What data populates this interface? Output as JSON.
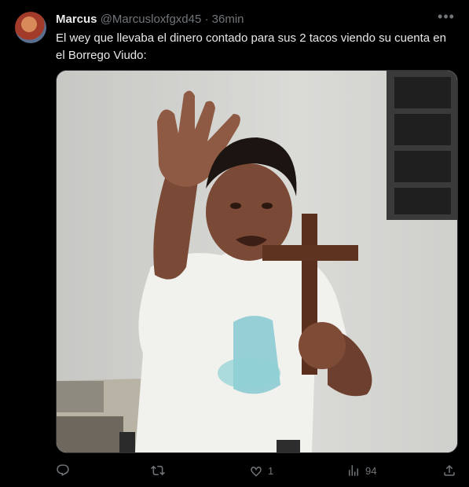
{
  "tweet": {
    "author_name": "Marcus",
    "author_handle": "@Marcusloxfgxd45",
    "separator": "·",
    "time": "36min",
    "more_label": "•••",
    "text": "El wey que llevaba el dinero contado para sus 2 tacos viendo su cuenta en el Borrego Viudo:"
  },
  "actions": {
    "reply_count": "",
    "retweet_count": "",
    "like_count": "1",
    "views_count": "94"
  },
  "icons": [
    "reply-icon",
    "retweet-icon",
    "like-icon",
    "views-icon",
    "share-icon",
    "more-icon"
  ],
  "colors": {
    "background": "#000000",
    "text": "#e7e9ea",
    "secondary": "#71767b",
    "border": "#2f3336"
  }
}
